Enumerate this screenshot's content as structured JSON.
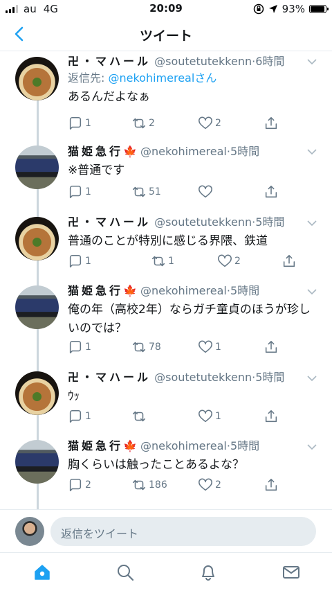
{
  "status_bar": {
    "carrier": "au",
    "network": "4G",
    "time": "20:09",
    "battery": "93%",
    "battery_level": 0.93
  },
  "header": {
    "title": "ツイート"
  },
  "tweets": [
    {
      "name": "卍・マハール",
      "handle": "@soutetutekkenn",
      "sep": "·",
      "time": "6時間",
      "reply_prefix": "返信先: ",
      "reply_to": "@nekohimerealさん",
      "text": "あるんだよなぁ",
      "replies": "1",
      "retweets": "2",
      "likes": "2",
      "avatar": "food-avatar"
    },
    {
      "name": "猫姫急行",
      "emoji": "🍁",
      "handle": "@nekohimereal",
      "sep": "·",
      "time": "5時間",
      "text": "※普通です",
      "replies": "1",
      "retweets": "51",
      "likes": "",
      "avatar": "train-avatar"
    },
    {
      "name": "卍・マハール",
      "handle": "@soutetutekkenn",
      "sep": "·",
      "time": "5時間",
      "text": "普通のことが特別に感じる界隈、鉄道",
      "replies": "1",
      "retweets": "1",
      "likes": "2",
      "avatar": "food-avatar"
    },
    {
      "name": "猫姫急行",
      "emoji": "🍁",
      "handle": "@nekohimereal",
      "sep": "·",
      "time": "5時間",
      "text_line1": "俺の年（高校2年）ならガチ童貞のほうが珍し",
      "text_line2": "いのでは？",
      "replies": "1",
      "retweets": "78",
      "likes": "1",
      "avatar": "train-avatar"
    },
    {
      "name": "卍・マハール",
      "handle": "@soutetutekkenn",
      "sep": "·",
      "time": "5時間",
      "text": "ｳｯ",
      "replies": "1",
      "retweets": "",
      "likes": "1",
      "avatar": "food-avatar"
    },
    {
      "name": "猫姫急行",
      "emoji": "🍁",
      "handle": "@nekohimereal",
      "sep": "·",
      "time": "5時間",
      "text": "胸くらいは触ったことあるよな？",
      "replies": "2",
      "retweets": "186",
      "likes": "2",
      "avatar": "train-avatar"
    }
  ],
  "composer": {
    "placeholder": "返信をツイート"
  },
  "tabbar": {
    "items": [
      "home-icon",
      "search-icon",
      "bell-icon",
      "mail-icon"
    ],
    "active": "home-icon"
  },
  "colors": {
    "accent": "#1da1f2",
    "secondary_text": "#657786",
    "divider": "#e6ecf0"
  }
}
